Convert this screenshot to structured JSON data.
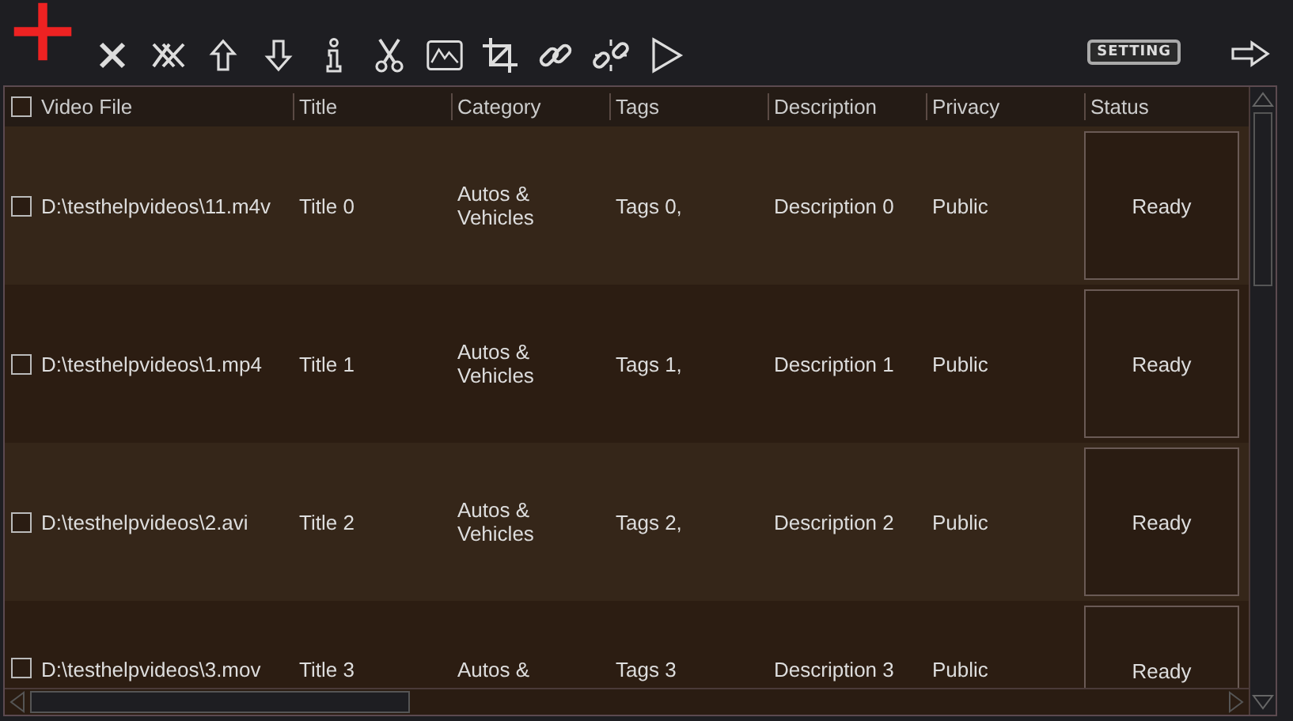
{
  "toolbar": {
    "setting_button": "SETTING"
  },
  "table": {
    "select_all": {
      "checked": false
    },
    "columns": [
      "Video File",
      "Title",
      "Category",
      "Tags",
      "Description",
      "Privacy",
      "Status"
    ],
    "rows": [
      {
        "checked": false,
        "video_file": "D:\\testhelpvideos\\11.m4v",
        "title": "Title 0",
        "category": "Autos & Vehicles",
        "tags": "Tags 0,",
        "description": "Description 0",
        "privacy": "Public",
        "status": "Ready"
      },
      {
        "checked": false,
        "video_file": "D:\\testhelpvideos\\1.mp4",
        "title": "Title 1",
        "category": "Autos & Vehicles",
        "tags": "Tags 1,",
        "description": "Description 1",
        "privacy": "Public",
        "status": "Ready"
      },
      {
        "checked": false,
        "video_file": "D:\\testhelpvideos\\2.avi",
        "title": "Title 2",
        "category": "Autos & Vehicles",
        "tags": "Tags 2,",
        "description": "Description 2",
        "privacy": "Public",
        "status": "Ready"
      },
      {
        "checked": false,
        "video_file": "D:\\testhelpvideos\\3.mov",
        "title": "Title 3",
        "category": "Autos &",
        "tags": "Tags 3",
        "description": "Description 3",
        "privacy": "Public",
        "status": "Ready"
      }
    ]
  }
}
